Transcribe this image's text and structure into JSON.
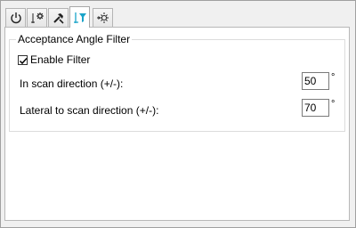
{
  "tabs": [
    {
      "icon": "power-icon"
    },
    {
      "icon": "gear-adjust-icon"
    },
    {
      "icon": "tools-icon"
    },
    {
      "icon": "filter-icon",
      "active": true
    },
    {
      "icon": "scan-sun-icon"
    }
  ],
  "group": {
    "title": "Acceptance Angle Filter",
    "enable_label": "Enable Filter",
    "enable_checked": true,
    "scan_label": "In scan direction (+/-):",
    "scan_value": "50",
    "lateral_label": "Lateral to scan direction (+/-):",
    "lateral_value": "70",
    "unit": "°"
  },
  "colors": {
    "active_icon": "#1aa3c8"
  }
}
